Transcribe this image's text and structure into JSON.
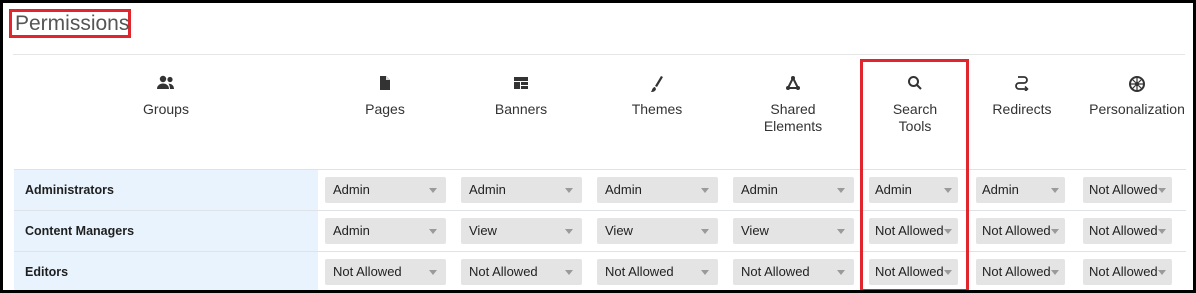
{
  "page": {
    "title": "Permissions"
  },
  "columns": [
    {
      "key": "groups",
      "label_lines": [
        "Groups"
      ],
      "icon": "groups-icon"
    },
    {
      "key": "pages",
      "label_lines": [
        "Pages"
      ],
      "icon": "page-icon"
    },
    {
      "key": "banners",
      "label_lines": [
        "Banners"
      ],
      "icon": "banner-icon"
    },
    {
      "key": "themes",
      "label_lines": [
        "Themes"
      ],
      "icon": "brush-icon"
    },
    {
      "key": "shared_elements",
      "label_lines": [
        "Shared",
        "Elements"
      ],
      "icon": "shared-elements-icon"
    },
    {
      "key": "search_tools",
      "label_lines": [
        "Search",
        "Tools"
      ],
      "icon": "search-icon"
    },
    {
      "key": "redirects",
      "label_lines": [
        "Redirects"
      ],
      "icon": "redirect-icon"
    },
    {
      "key": "personalization",
      "label_lines": [
        "Personalization"
      ],
      "icon": "personalization-icon"
    }
  ],
  "rows": [
    {
      "group": "Administrators",
      "values": [
        "Admin",
        "Admin",
        "Admin",
        "Admin",
        "Admin",
        "Admin",
        "Not Allowed"
      ]
    },
    {
      "group": "Content Managers",
      "values": [
        "Admin",
        "View",
        "View",
        "View",
        "Not Allowed",
        "Not Allowed",
        "Not Allowed"
      ]
    },
    {
      "group": "Editors",
      "values": [
        "Not Allowed",
        "Not Allowed",
        "Not Allowed",
        "Not Allowed",
        "Not Allowed",
        "Not Allowed",
        "Not Allowed"
      ]
    }
  ],
  "colors": {
    "highlight": "#e0262c",
    "group_column_bg": "#e8f3fd",
    "select_bg": "#e4e4e4"
  }
}
